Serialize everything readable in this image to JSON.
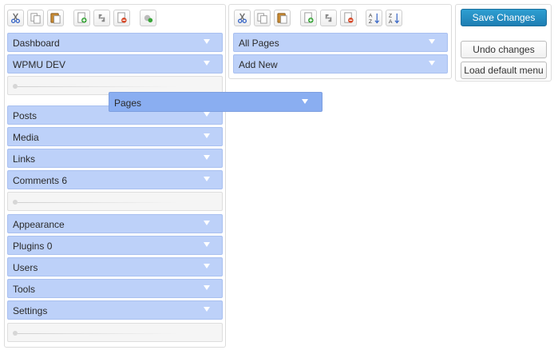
{
  "left_toolbar": {
    "icons": [
      "cut-icon",
      "copy-icon",
      "paste-icon",
      "new-menu-icon",
      "new-separator-icon",
      "delete-icon",
      "hide-icon"
    ]
  },
  "sub_toolbar": {
    "icons": [
      "cut-icon",
      "copy-icon",
      "paste-icon",
      "new-item-icon",
      "new-separator-icon",
      "delete-icon",
      "sort-ascending-icon",
      "sort-descending-icon"
    ]
  },
  "menu": {
    "group1": [
      {
        "label": "Dashboard"
      },
      {
        "label": "WPMU DEV"
      }
    ],
    "group2": [
      {
        "label": "Posts"
      },
      {
        "label": "Media"
      },
      {
        "label": "Links"
      },
      {
        "label": "Comments 6"
      }
    ],
    "group3": [
      {
        "label": "Appearance"
      },
      {
        "label": "Plugins 0"
      },
      {
        "label": "Users"
      },
      {
        "label": "Tools"
      },
      {
        "label": "Settings"
      }
    ]
  },
  "dragging_item": {
    "label": "Pages"
  },
  "submenu": [
    {
      "label": "All Pages"
    },
    {
      "label": "Add New"
    }
  ],
  "actions": {
    "save_label": "Save Changes",
    "undo_label": "Undo changes",
    "default_label": "Load default menu"
  },
  "colors": {
    "menu_item_bg": "#bdd1f9",
    "dragging_item_bg": "#8aaef1",
    "save_button_bg": "#1e7eb3"
  }
}
